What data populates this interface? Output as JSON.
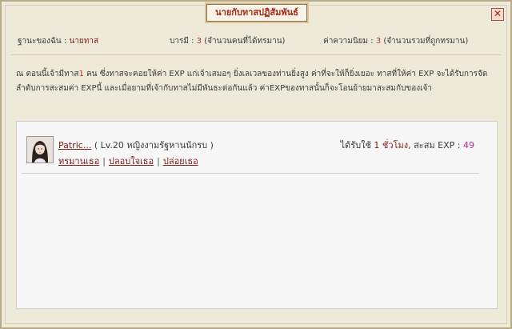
{
  "window": {
    "title": "นายกับทาสปฏิสัมพันธ์",
    "close_glyph": "✕"
  },
  "info": {
    "status_label": "ฐานะของฉัน :",
    "status_value": "นายทาส",
    "merit_label": "บารมี :",
    "merit_value": "3",
    "merit_note": "(จำนวนคนที่ได้ทรมาน)",
    "pop_label": "ค่าความนิยม :",
    "pop_value": "3",
    "pop_note": "(จำนวนรวมที่ถูกทรมาน)"
  },
  "description": {
    "part1": "ณ ตอนนี้เจ้ามีทาส",
    "count": "1",
    "part2": " คน ซึ่งทาสจะคอยให้ค่า EXP แก่เจ้าเสมอๆ ยิ่งเลเวลของท่านยิ่งสูง ค่าที่จะให้ก็ยิ่งเยอะ ทาสที่ให้ค่า EXP จะได้รับการจัดลำดับการสะสมค่า EXPนี้ และเมื่อยามที่เจ้ากับทาสไม่มีพันธะต่อกันแล้ว ค่าEXPของทาสนั้นก็จะโอนย้ายมาสะสมกับของเจ้า"
  },
  "slave": {
    "name": "Patric...",
    "details": "( Lv.20 หญิงงามรัฐหานนักรบ )",
    "exp_prefix": "ได้รับใช้",
    "exp_time": "1 ชั่วโมง",
    "exp_mid": ", สะสม EXP :",
    "exp_value": "49",
    "actions": [
      "ทรมานเธอ",
      "ปลอบใจเธอ",
      "ปล่อยเธอ"
    ],
    "separator": "|"
  }
}
